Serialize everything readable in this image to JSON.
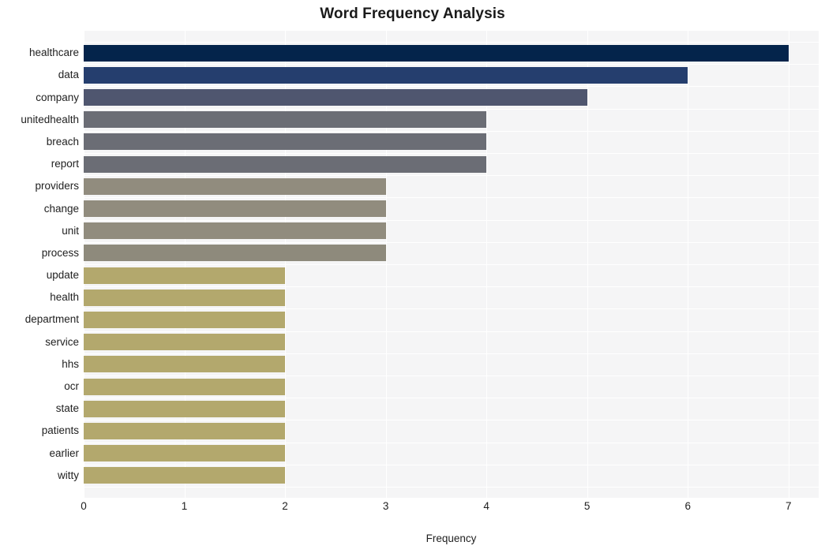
{
  "chart_data": {
    "type": "bar",
    "orientation": "horizontal",
    "title": "Word Frequency Analysis",
    "xlabel": "Frequency",
    "ylabel": "",
    "xlim": [
      0,
      7.3
    ],
    "xticks": [
      "0",
      "1",
      "2",
      "3",
      "4",
      "5",
      "6",
      "7"
    ],
    "xtick_values": [
      0,
      1,
      2,
      3,
      4,
      5,
      6,
      7
    ],
    "grid": true,
    "legend": "none",
    "categories": [
      "healthcare",
      "data",
      "company",
      "unitedhealth",
      "breach",
      "report",
      "providers",
      "change",
      "unit",
      "process",
      "update",
      "health",
      "department",
      "service",
      "hhs",
      "ocr",
      "state",
      "patients",
      "earlier",
      "witty"
    ],
    "values": [
      7,
      6,
      5,
      4,
      4,
      4,
      3,
      3,
      3,
      3,
      2,
      2,
      2,
      2,
      2,
      2,
      2,
      2,
      2,
      2
    ],
    "bar_colors": [
      "#04244b",
      "#253e6e",
      "#4f566f",
      "#6b6d75",
      "#6b6d75",
      "#6b6d75",
      "#918c7e",
      "#918c7e",
      "#918c7e",
      "#8e8a7c",
      "#b3a86d",
      "#b3a86d",
      "#b3a86d",
      "#b3a86d",
      "#b3a86d",
      "#b3a86d",
      "#b3a86d",
      "#b3a86d",
      "#b3a86d",
      "#b3a86d"
    ],
    "plot_background": "#f5f5f6",
    "grid_color": "#ffffff",
    "figure_background": "#ffffff"
  }
}
